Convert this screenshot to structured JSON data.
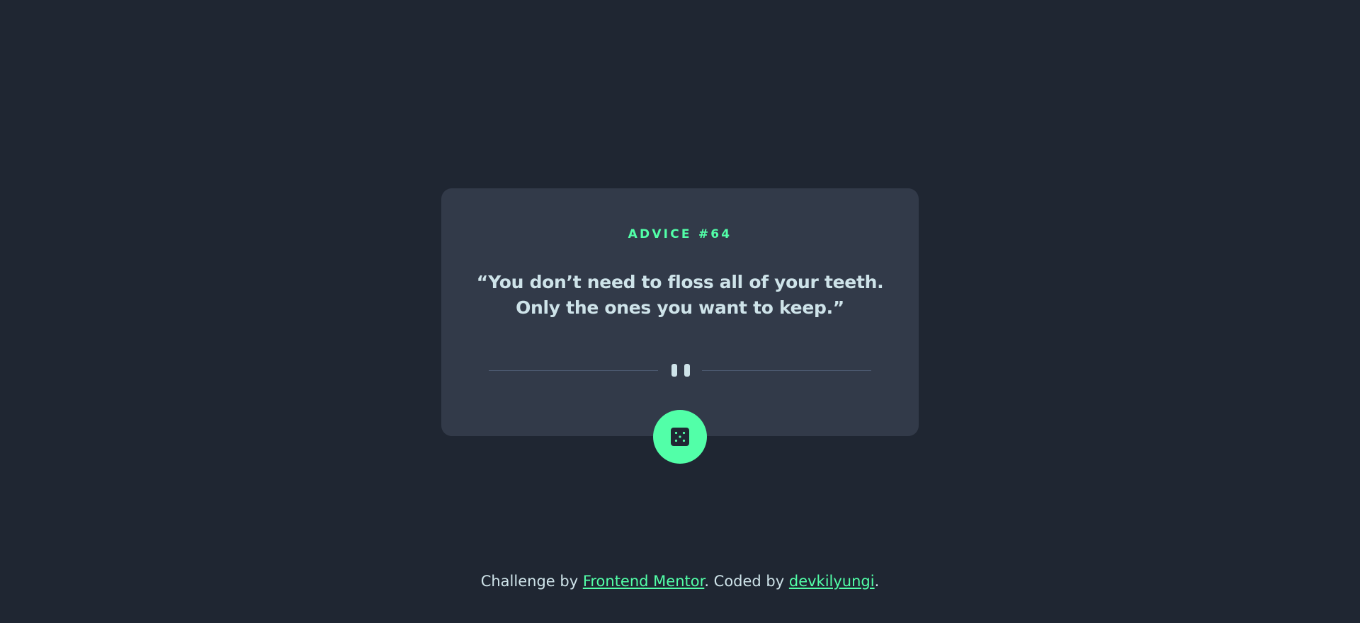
{
  "card": {
    "advice_id": "ADVICE #64",
    "advice_text": "“You don’t need to floss all of your teeth. Only the ones you want to keep.”"
  },
  "divider": {
    "icon": "pause-icon"
  },
  "dice_button": {
    "icon": "dice-icon"
  },
  "footer": {
    "prefix": "Challenge by ",
    "challenge_link": "Frontend Mentor",
    "middle": ". Coded by ",
    "author_link": "devkilyungi",
    "suffix": "."
  },
  "colors": {
    "background": "#1f2632",
    "card": "#323a49",
    "accent": "#52ffa8",
    "text": "#cee3e9",
    "divider": "#4f5d74"
  }
}
